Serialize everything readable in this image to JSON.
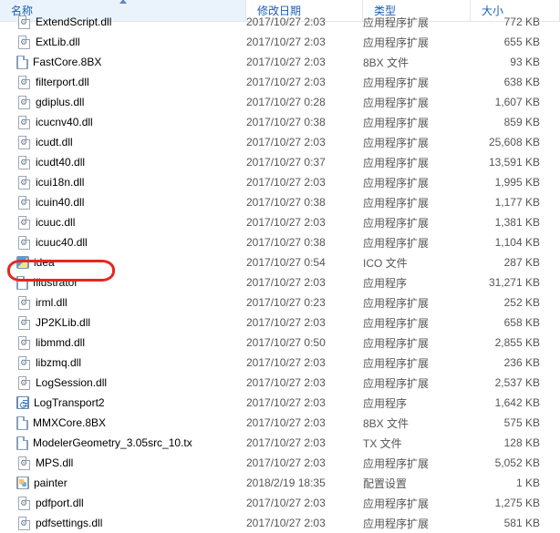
{
  "columns": {
    "name": "名称",
    "date": "修改日期",
    "type": "类型",
    "size": "大小"
  },
  "highlight_index": 12,
  "files": [
    {
      "icon": "dll",
      "name": "ExtendScript.dll",
      "date": "2017/10/27 2:03",
      "type": "应用程序扩展",
      "size": "772 KB"
    },
    {
      "icon": "dll",
      "name": "ExtLib.dll",
      "date": "2017/10/27 2:03",
      "type": "应用程序扩展",
      "size": "655 KB"
    },
    {
      "icon": "page",
      "name": "FastCore.8BX",
      "date": "2017/10/27 2:03",
      "type": "8BX 文件",
      "size": "93 KB"
    },
    {
      "icon": "dll",
      "name": "filterport.dll",
      "date": "2017/10/27 2:03",
      "type": "应用程序扩展",
      "size": "638 KB"
    },
    {
      "icon": "dll",
      "name": "gdiplus.dll",
      "date": "2017/10/27 0:28",
      "type": "应用程序扩展",
      "size": "1,607 KB"
    },
    {
      "icon": "dll",
      "name": "icucnv40.dll",
      "date": "2017/10/27 0:38",
      "type": "应用程序扩展",
      "size": "859 KB"
    },
    {
      "icon": "dll",
      "name": "icudt.dll",
      "date": "2017/10/27 2:03",
      "type": "应用程序扩展",
      "size": "25,608 KB"
    },
    {
      "icon": "dll",
      "name": "icudt40.dll",
      "date": "2017/10/27 0:37",
      "type": "应用程序扩展",
      "size": "13,591 KB"
    },
    {
      "icon": "dll",
      "name": "icui18n.dll",
      "date": "2017/10/27 2:03",
      "type": "应用程序扩展",
      "size": "1,995 KB"
    },
    {
      "icon": "dll",
      "name": "icuin40.dll",
      "date": "2017/10/27 0:38",
      "type": "应用程序扩展",
      "size": "1,177 KB"
    },
    {
      "icon": "dll",
      "name": "icuuc.dll",
      "date": "2017/10/27 2:03",
      "type": "应用程序扩展",
      "size": "1,381 KB"
    },
    {
      "icon": "dll",
      "name": "icuuc40.dll",
      "date": "2017/10/27 0:38",
      "type": "应用程序扩展",
      "size": "1,104 KB"
    },
    {
      "icon": "ico",
      "name": "idea",
      "date": "2017/10/27 0:54",
      "type": "ICO 文件",
      "size": "287 KB"
    },
    {
      "icon": "page",
      "name": "Illustrator",
      "date": "2017/10/27 2:03",
      "type": "应用程序",
      "size": "31,271 KB"
    },
    {
      "icon": "dll",
      "name": "irml.dll",
      "date": "2017/10/27 0:23",
      "type": "应用程序扩展",
      "size": "252 KB"
    },
    {
      "icon": "dll",
      "name": "JP2KLib.dll",
      "date": "2017/10/27 2:03",
      "type": "应用程序扩展",
      "size": "658 KB"
    },
    {
      "icon": "dll",
      "name": "libmmd.dll",
      "date": "2017/10/27 0:50",
      "type": "应用程序扩展",
      "size": "2,855 KB"
    },
    {
      "icon": "dll",
      "name": "libzmq.dll",
      "date": "2017/10/27 2:03",
      "type": "应用程序扩展",
      "size": "236 KB"
    },
    {
      "icon": "dll",
      "name": "LogSession.dll",
      "date": "2017/10/27 2:03",
      "type": "应用程序扩展",
      "size": "2,537 KB"
    },
    {
      "icon": "log",
      "name": "LogTransport2",
      "date": "2017/10/27 2:03",
      "type": "应用程序",
      "size": "1,642 KB"
    },
    {
      "icon": "page",
      "name": "MMXCore.8BX",
      "date": "2017/10/27 2:03",
      "type": "8BX 文件",
      "size": "575 KB"
    },
    {
      "icon": "page",
      "name": "ModelerGeometry_3.05src_10.tx",
      "date": "2017/10/27 2:03",
      "type": "TX 文件",
      "size": "128 KB"
    },
    {
      "icon": "dll",
      "name": "MPS.dll",
      "date": "2017/10/27 2:03",
      "type": "应用程序扩展",
      "size": "5,052 KB"
    },
    {
      "icon": "paint",
      "name": "painter",
      "date": "2018/2/19 18:35",
      "type": "配置设置",
      "size": "1 KB"
    },
    {
      "icon": "dll",
      "name": "pdfport.dll",
      "date": "2017/10/27 2:03",
      "type": "应用程序扩展",
      "size": "1,275 KB"
    },
    {
      "icon": "dll",
      "name": "pdfsettings.dll",
      "date": "2017/10/27 2:03",
      "type": "应用程序扩展",
      "size": "581 KB"
    }
  ]
}
